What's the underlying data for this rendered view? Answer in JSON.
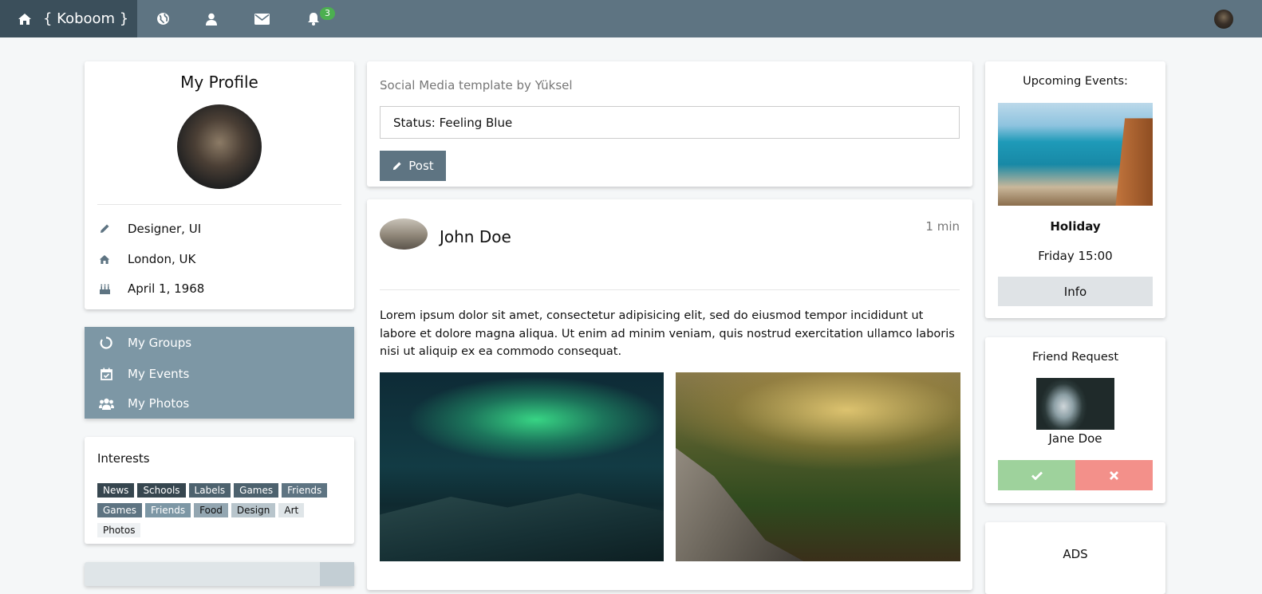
{
  "navbar": {
    "brand": "{ Koboom }",
    "notification_count": "3",
    "icons": [
      "home-icon",
      "globe-icon",
      "user-icon",
      "envelope-icon",
      "bell-icon"
    ]
  },
  "profile": {
    "title": "My Profile",
    "details": [
      {
        "icon": "pencil-icon",
        "text": "Designer, UI"
      },
      {
        "icon": "home-icon",
        "text": "London, UK"
      },
      {
        "icon": "birthday-cake-icon",
        "text": "April 1, 1968"
      }
    ]
  },
  "menu": {
    "items": [
      {
        "icon": "circle-notch-icon",
        "label": "My Groups"
      },
      {
        "icon": "calendar-check-icon",
        "label": "My Events"
      },
      {
        "icon": "users-icon",
        "label": "My Photos"
      }
    ]
  },
  "interests": {
    "title": "Interests",
    "tags": [
      {
        "label": "News",
        "bg": "#36464f",
        "fg": "#ffffff"
      },
      {
        "label": "Schools",
        "bg": "#36464f",
        "fg": "#ffffff"
      },
      {
        "label": "Labels",
        "bg": "#4d626e",
        "fg": "#ffffff"
      },
      {
        "label": "Games",
        "bg": "#4d626e",
        "fg": "#ffffff"
      },
      {
        "label": "Friends",
        "bg": "#5e7482",
        "fg": "#ffffff"
      },
      {
        "label": "Games",
        "bg": "#5e7482",
        "fg": "#ffffff"
      },
      {
        "label": "Friends",
        "bg": "#7d97a5",
        "fg": "#ffffff"
      },
      {
        "label": "Food",
        "bg": "#93a6b1",
        "fg": "#111111"
      },
      {
        "label": "Design",
        "bg": "#b8c5cc",
        "fg": "#111111"
      },
      {
        "label": "Art",
        "bg": "#dfe5e8",
        "fg": "#111111"
      },
      {
        "label": "Photos",
        "bg": "#eef1f3",
        "fg": "#111111"
      }
    ]
  },
  "composer": {
    "subtitle": "Social Media template by Yüksel",
    "status_value": "Status: Feeling Blue",
    "post_label": "Post"
  },
  "feed_post": {
    "author": "John Doe",
    "time": "1 min",
    "body": "Lorem ipsum dolor sit amet, consectetur adipisicing elit, sed do eiusmod tempor incididunt ut labore et dolore magna aliqua. Ut enim ad minim veniam, quis nostrud exercitation ullamco laboris nisi ut aliquip ex ea commodo consequat."
  },
  "events": {
    "title": "Upcoming Events:",
    "name": "Holiday",
    "time": "Friday 15:00",
    "button": "Info"
  },
  "friend_request": {
    "title": "Friend Request",
    "name": "Jane Doe"
  },
  "ads": {
    "title": "ADS"
  },
  "colors": {
    "topbar": "#5e7482",
    "brand_bg": "#3b4f5b",
    "accent": "#5e7482",
    "menu_bg": "#7d97a5",
    "accept": "#9ed29c",
    "reject": "#f3908a",
    "badge": "#4caf50"
  }
}
